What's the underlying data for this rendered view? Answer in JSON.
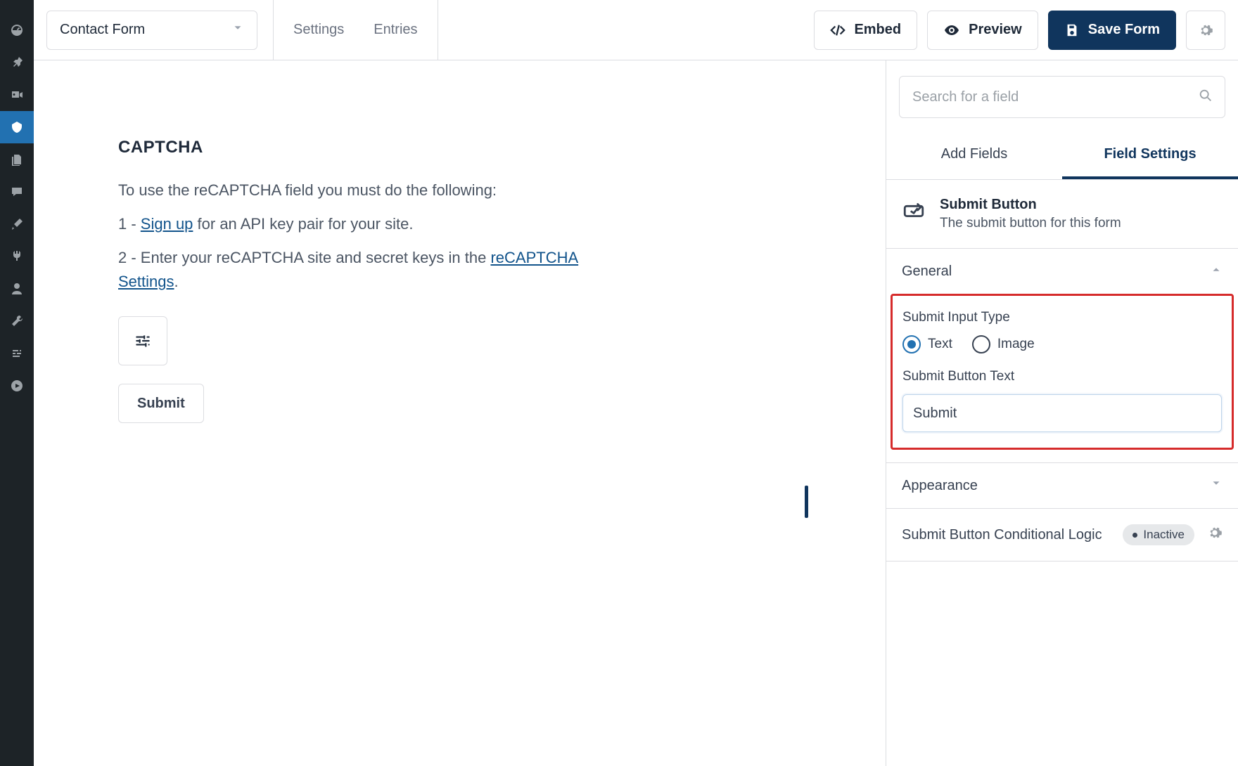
{
  "admin_nav": {
    "items": [
      {
        "name": "dashboard-icon"
      },
      {
        "name": "pin-icon"
      },
      {
        "name": "media-icon"
      },
      {
        "name": "forms-icon",
        "current": true
      },
      {
        "name": "pages-icon"
      },
      {
        "name": "comments-icon"
      },
      {
        "name": "brush-icon"
      },
      {
        "name": "plugins-icon"
      },
      {
        "name": "users-icon"
      },
      {
        "name": "tools-icon"
      },
      {
        "name": "settings-icon"
      },
      {
        "name": "play-icon"
      }
    ]
  },
  "topbar": {
    "form_selector": "Contact Form",
    "tabs": [
      "Settings",
      "Entries"
    ],
    "embed": "Embed",
    "preview": "Preview",
    "save": "Save Form"
  },
  "canvas": {
    "section_title": "CAPTCHA",
    "p1_pre": "To use the reCAPTCHA field you must do the following:",
    "p2_pre": "1 - ",
    "p2_link": "Sign up",
    "p2_post": " for an API key pair for your site.",
    "p3_pre": "2 - Enter your reCAPTCHA site and secret keys in the ",
    "p3_link": "reCAPTCHA Settings",
    "p3_post": ".",
    "submit_label": "Submit"
  },
  "panel": {
    "search_placeholder": "Search for a field",
    "tabs": {
      "add": "Add Fields",
      "settings": "Field Settings"
    },
    "field_header": {
      "title": "Submit Button",
      "desc": "The submit button for this form"
    },
    "sections": {
      "general": "General",
      "submit_type_label": "Submit Input Type",
      "options": {
        "text": "Text",
        "image": "Image",
        "selected": "text"
      },
      "button_text_label": "Submit Button Text",
      "button_text_value": "Submit",
      "appearance": "Appearance",
      "cond_logic_label": "Submit Button Conditional Logic",
      "cond_logic_status": "Inactive"
    }
  }
}
